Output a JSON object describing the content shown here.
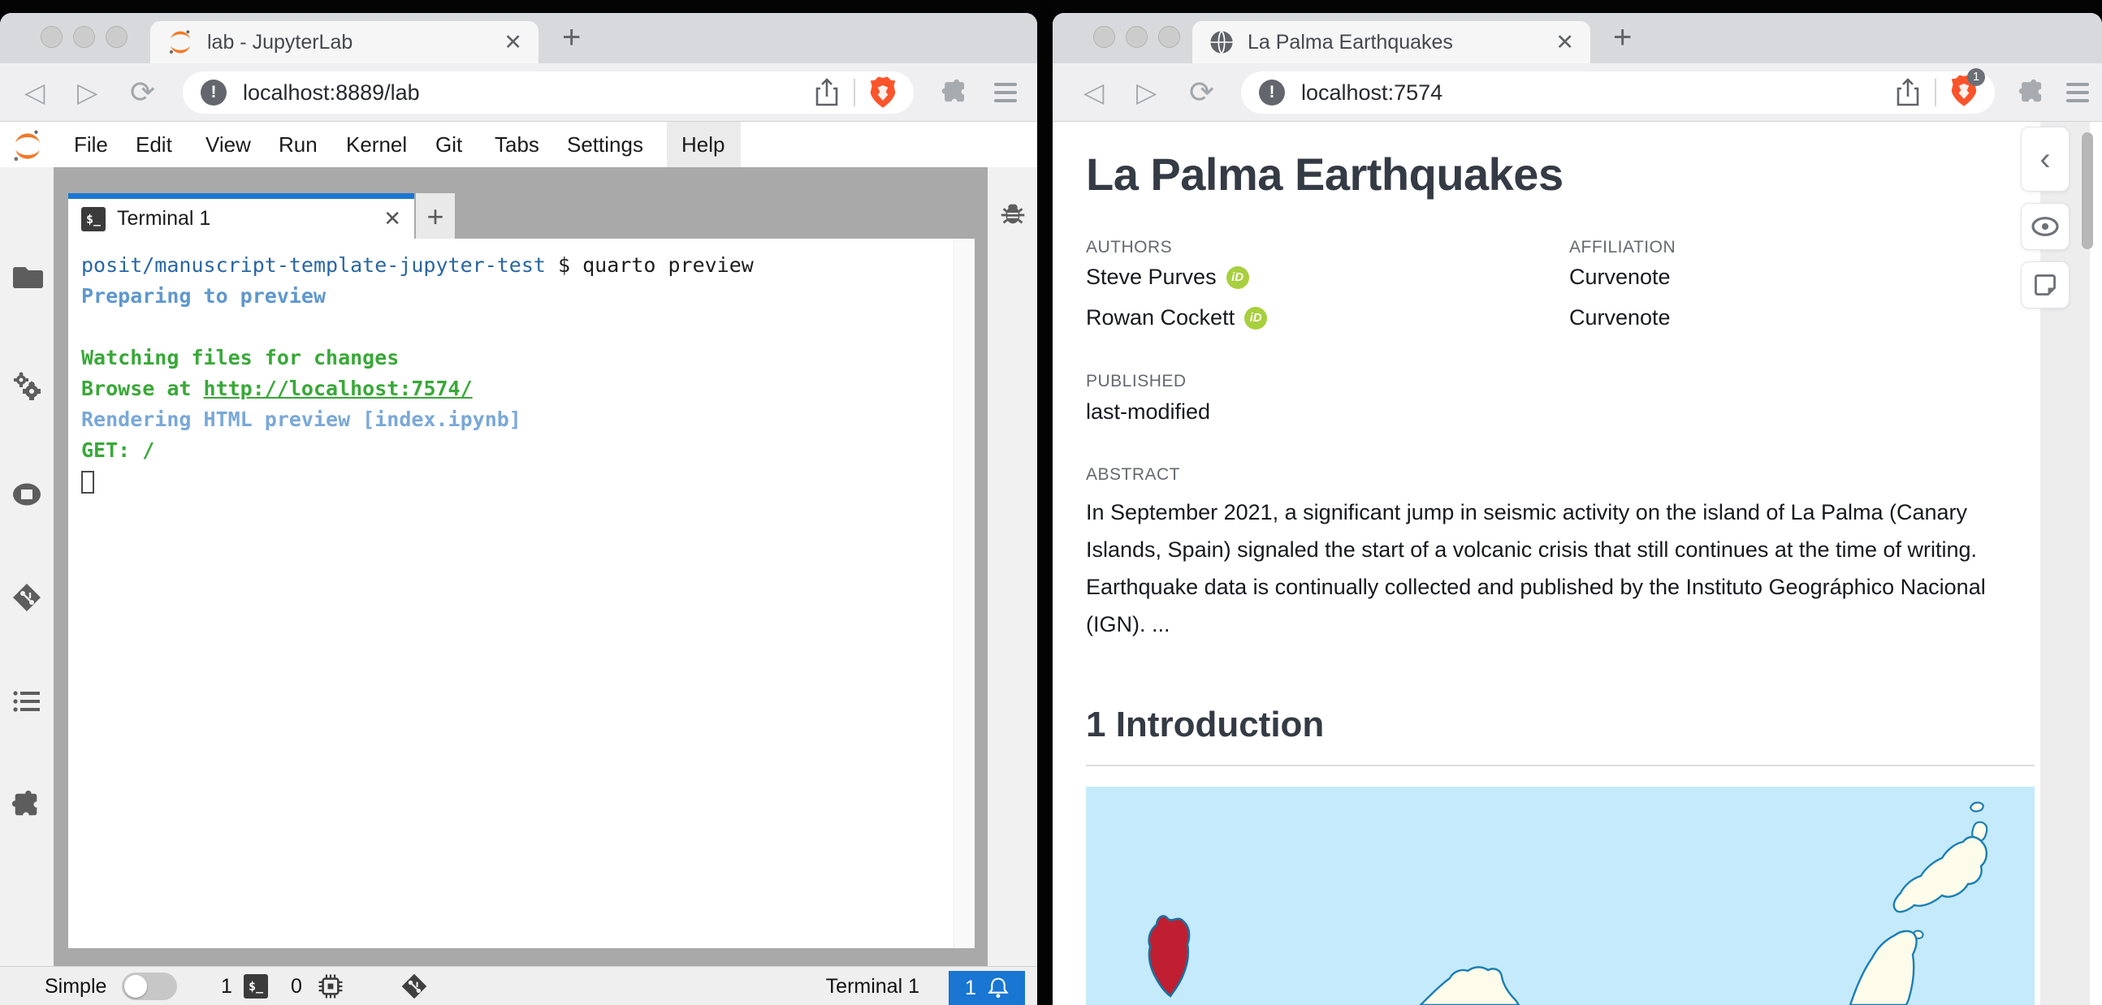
{
  "glyphs": {
    "close": "✕",
    "plus": "+",
    "back": "◁",
    "forward": "▷",
    "reload": "⟳",
    "chevron_left": "‹",
    "site_info": "!",
    "orcid": "iD",
    "terminal_badge": "$_"
  },
  "left_window": {
    "tab_title": "lab - JupyterLab",
    "url": "localhost:8889/lab",
    "menu": [
      "File",
      "Edit",
      "View",
      "Run",
      "Kernel",
      "Git",
      "Tabs",
      "Settings",
      "Help"
    ],
    "terminal_tab_label": "Terminal 1",
    "terminal": {
      "prompt_path": "posit/manuscript-template-jupyter-test",
      "prompt_cmd": " $ quarto preview",
      "preparing": "Preparing to preview",
      "watching": "Watching files for changes",
      "browse_prefix": "Browse at ",
      "browse_url": "http://localhost:7574/",
      "rendering": "Rendering HTML preview [index.ipynb]",
      "get_line": "GET: /"
    },
    "statusbar": {
      "mode_label": "Simple",
      "terminals_count": "1",
      "kernels_count": "0",
      "context_label": "Terminal 1",
      "notifications_count": "1"
    }
  },
  "right_window": {
    "tab_title": "La Palma Earthquakes",
    "url": "localhost:7574",
    "shields_badge": "1",
    "document": {
      "title": "La Palma Earthquakes",
      "authors_label": "AUTHORS",
      "affiliation_label": "AFFILIATION",
      "authors": [
        {
          "name": "Steve Purves",
          "affiliation": "Curvenote"
        },
        {
          "name": "Rowan Cockett",
          "affiliation": "Curvenote"
        }
      ],
      "published_label": "PUBLISHED",
      "published_value": "last-modified",
      "abstract_label": "ABSTRACT",
      "abstract_text": "In September 2021, a significant jump in seismic activity on the island of La Palma (Canary Islands, Spain) signaled the start of a volcanic crisis that still continues at the time of writing. Earthquake data is continually collected and published by the Instituto Geográphico Nacional (IGN). ...",
      "section_heading": "1 Introduction"
    }
  },
  "colors": {
    "jupyterlab_accent": "#1976d2",
    "brave_orange": "#fb542b",
    "jupyter_orange": "#f37726",
    "orcid_green": "#a8cf3d",
    "terminal_path_blue": "#2a66a3",
    "terminal_steel_blue": "#5f97cd",
    "terminal_green": "#39a839",
    "terminal_light_blue": "#79a8d8",
    "map_sea": "#c5eafb",
    "map_island": "#fdfbe9",
    "map_island_stroke": "#1b7fb4",
    "map_la_palma_red": "#c01f31"
  }
}
